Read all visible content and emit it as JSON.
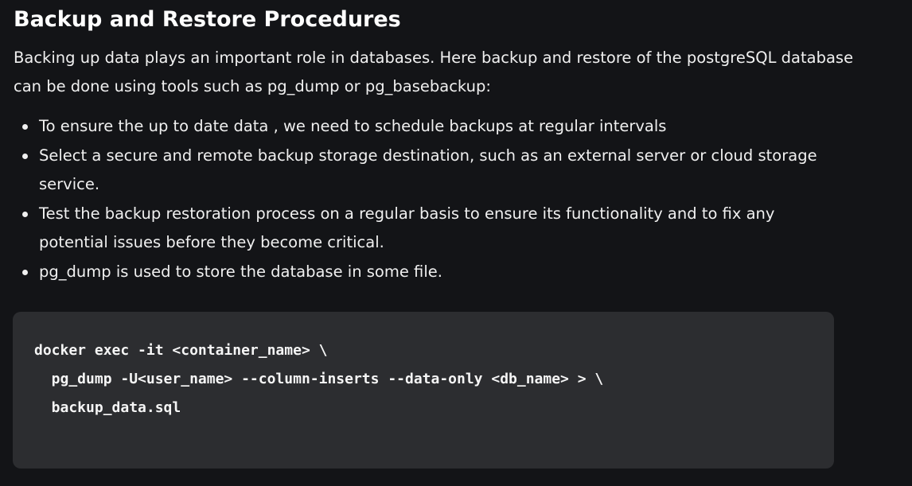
{
  "heading": "Backup and Restore Procedures",
  "intro": "Backing up data plays an important role in databases. Here backup and restore of the postgreSQL database can be done using tools such as pg_dump or pg_basebackup:",
  "bullets": [
    "To ensure the up to date data , we need to schedule backups at regular intervals",
    "Select a secure and remote backup storage destination, such as an external server or cloud storage service.",
    "Test the backup restoration process on a regular basis to ensure its functionality and to fix any potential issues before they become critical.",
    "pg_dump is used to store the database in some file."
  ],
  "code": {
    "lines": [
      "docker exec -it <container_name> \\",
      "  pg_dump -U<user_name> --column-inserts --data-only <db_name> > \\",
      "  backup_data.sql"
    ]
  },
  "colors": {
    "background": "#131417",
    "code_background": "#2c2d30",
    "text": "#f0f0f0"
  }
}
